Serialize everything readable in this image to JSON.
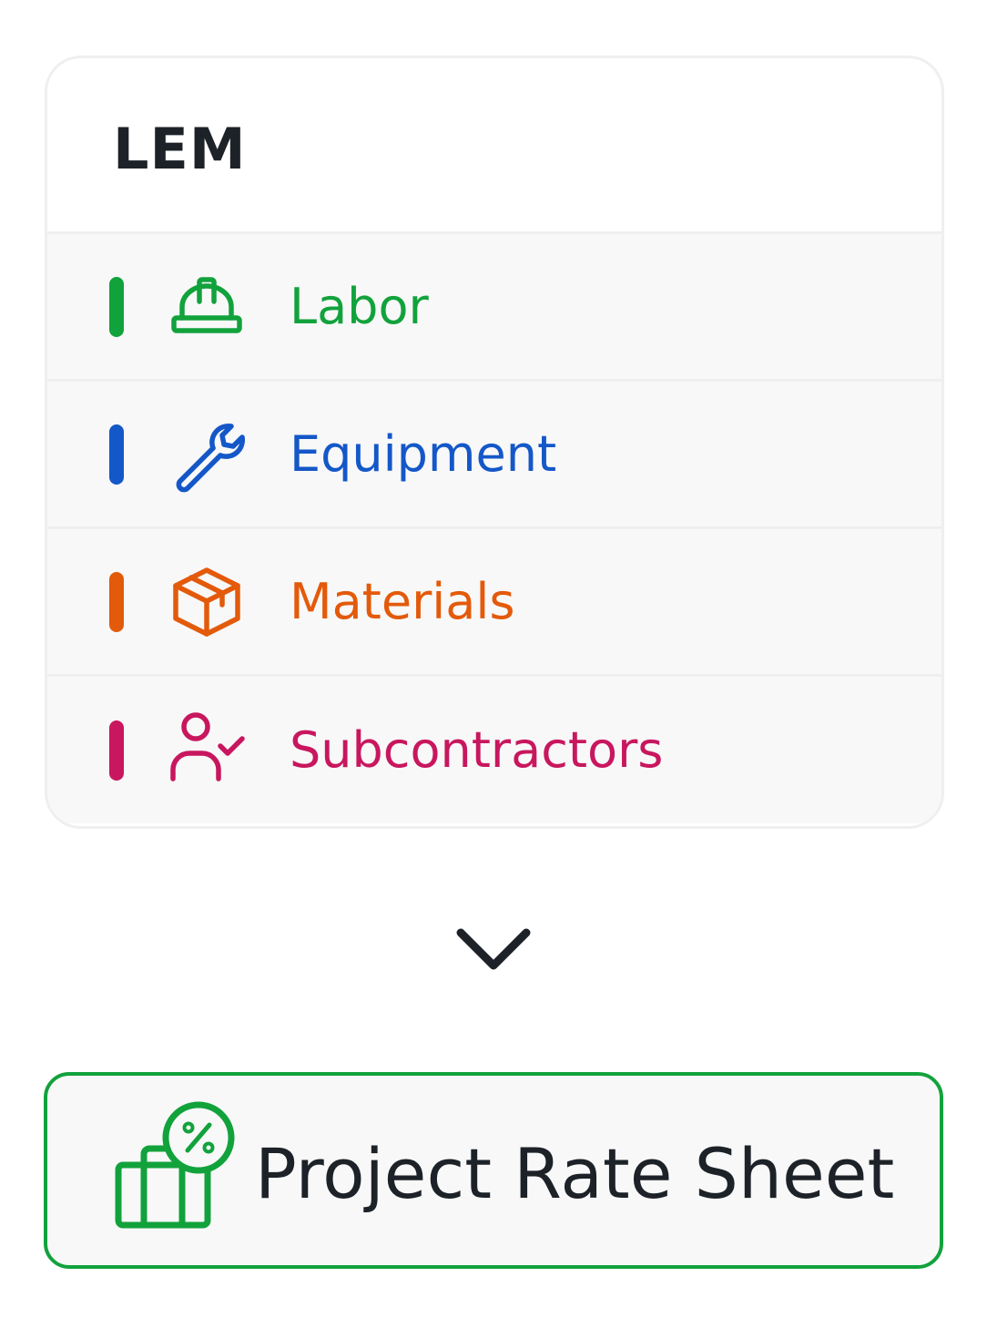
{
  "card": {
    "title": "LEM",
    "items": [
      {
        "label": "Labor",
        "icon": "hard-hat-icon",
        "color": "#12a23c"
      },
      {
        "label": "Equipment",
        "icon": "wrench-icon",
        "color": "#1457c8"
      },
      {
        "label": "Materials",
        "icon": "box-icon",
        "color": "#e35a0b"
      },
      {
        "label": "Subcontractors",
        "icon": "user-check-icon",
        "color": "#c8175e"
      }
    ]
  },
  "expand": {
    "icon": "chevron-down-icon",
    "color": "#1c2228"
  },
  "rate_button": {
    "label": "Project Rate Sheet",
    "icon": "briefcase-percent-icon",
    "color": "#12a23c"
  }
}
